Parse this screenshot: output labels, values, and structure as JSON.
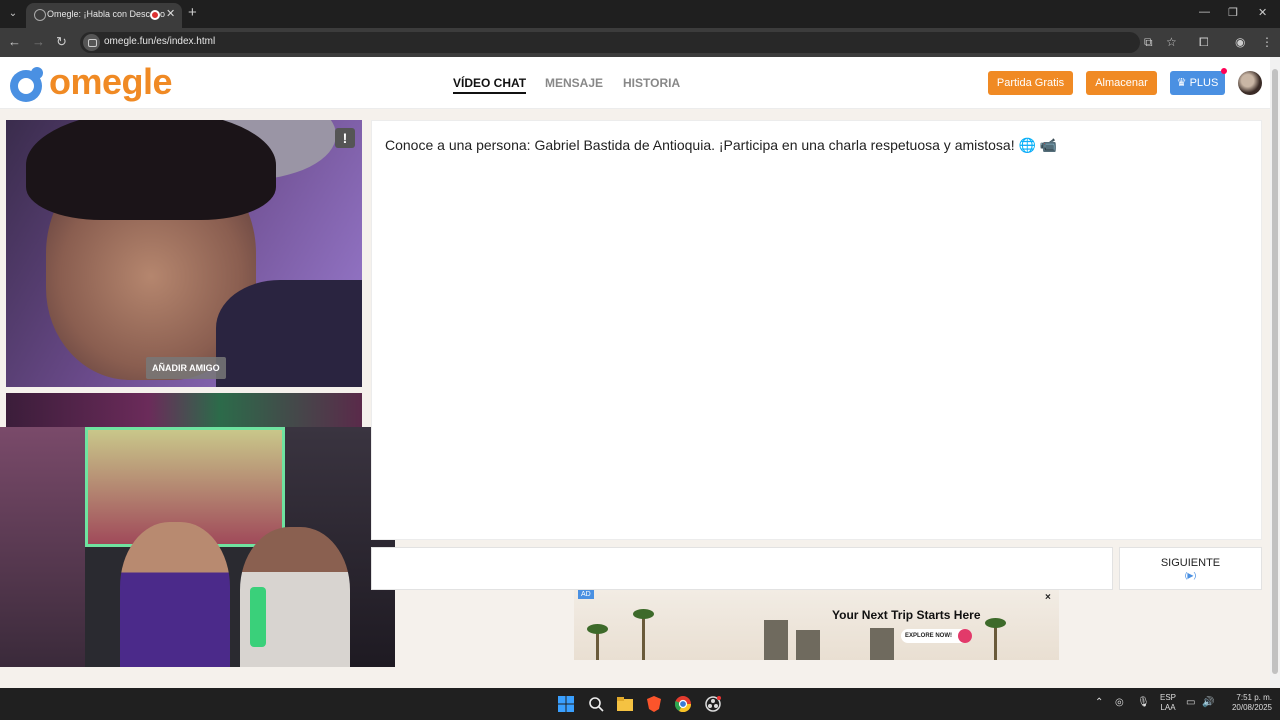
{
  "browser": {
    "tab_title": "Omegle: ¡Habla con Desconocidos!",
    "url": "omegle.fun/es/index.html"
  },
  "site": {
    "logo_text": "omegle",
    "nav": [
      {
        "label": "VÍDEO CHAT",
        "active": true
      },
      {
        "label": "MENSAJE",
        "active": false
      },
      {
        "label": "HISTORIA",
        "active": false
      }
    ],
    "buttons": {
      "free_match": "Partida Gratis",
      "store": "Almacenar",
      "plus": "PLUS"
    }
  },
  "video": {
    "report_label": "!",
    "add_friend_label": "AÑADIR AMIGO"
  },
  "chat": {
    "message": "Conoce a una persona: Gabriel Bastida de Antioquia. ¡Participa en una charla respetuosa y amistosa! 🌐 📹",
    "input_placeholder": "",
    "next_label": "SIGUIENTE",
    "next_hint": "(▶)"
  },
  "ad": {
    "badge": "AD",
    "title": "Your Next Trip Starts Here",
    "cta": "EXPLORE NOW!",
    "close": "×"
  },
  "taskbar": {
    "lang_line1": "ESP",
    "lang_line2": "LAA",
    "time": "7:51 p. m.",
    "date": "20/08/2025"
  },
  "colors": {
    "brand_orange": "#f08a24",
    "plus_blue": "#4a90e2",
    "page_bg": "#f5f1ec"
  }
}
